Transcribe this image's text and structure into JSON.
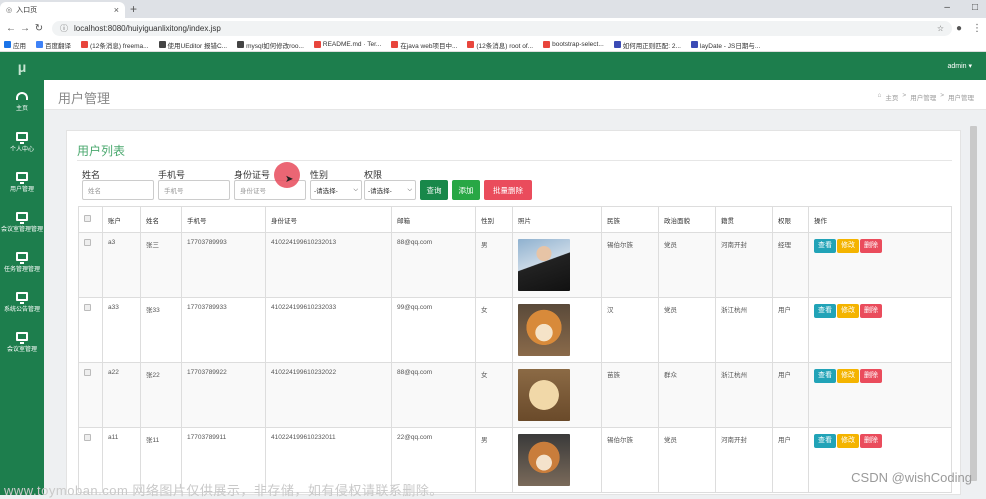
{
  "browser": {
    "tab_title": "入口页",
    "url": "localhost:8080/huiyiguanlixitong/index.jsp",
    "bookmarks": [
      "应用",
      "百度翻译",
      "(12条消息) freema...",
      "使用UEditor 报错C...",
      "mysql如何修改roo...",
      "README.md · Ter...",
      "在java web项目中...",
      "(12条消息) root of...",
      "bootstrap-select...",
      "如何用正则匹配: 2...",
      "layDate - JS日期与..."
    ]
  },
  "app": {
    "logo": "μ",
    "admin": "admin ▾",
    "page_title": "用户管理",
    "breadcrumb": [
      "主页",
      ">",
      "用户管理",
      ">",
      "用户管理"
    ]
  },
  "sidebar": {
    "items": [
      {
        "label": "主页",
        "icon": "dashboard-icon"
      },
      {
        "label": "个人中心",
        "icon": "monitor-icon"
      },
      {
        "label": "用户管理",
        "icon": "monitor-icon"
      },
      {
        "label": "会议室管理管理",
        "icon": "monitor-icon"
      },
      {
        "label": "任务管理管理",
        "icon": "monitor-icon"
      },
      {
        "label": "系统公告管理",
        "icon": "monitor-icon"
      },
      {
        "label": "会议室管理",
        "icon": "monitor-icon"
      }
    ]
  },
  "panel": {
    "title": "用户列表",
    "filters": {
      "name_label": "姓名",
      "name_placeholder": "姓名",
      "phone_label": "手机号",
      "phone_placeholder": "手机号",
      "id_label": "身份证号",
      "id_placeholder": "身份证号",
      "gender_label": "性别",
      "gender_value": "-请选择-",
      "perm_label": "权限",
      "perm_value": "-请选择-"
    },
    "buttons": {
      "search": "查询",
      "add": "添加",
      "batch_delete": "批量删除"
    }
  },
  "table": {
    "headers": [
      "账户",
      "姓名",
      "手机号",
      "身份证号",
      "邮箱",
      "性别",
      "照片",
      "民族",
      "政治面貌",
      "籍贯",
      "权限",
      "操作"
    ],
    "rows": [
      {
        "account": "a3",
        "name": "张三",
        "phone": "17703789993",
        "idcard": "410224199610232013",
        "email": "88@qq.com",
        "gender": "男",
        "ethnic": "锡伯尔族",
        "political": "党员",
        "origin": "河南开封",
        "perm": "经理"
      },
      {
        "account": "a33",
        "name": "张33",
        "phone": "17703789933",
        "idcard": "410224199610232033",
        "email": "99@qq.com",
        "gender": "女",
        "ethnic": "汉",
        "political": "党员",
        "origin": "浙江杭州",
        "perm": "用户"
      },
      {
        "account": "a22",
        "name": "张22",
        "phone": "17703789922",
        "idcard": "410224199610232022",
        "email": "88@qq.com",
        "gender": "女",
        "ethnic": "苗族",
        "political": "群众",
        "origin": "浙江杭州",
        "perm": "用户"
      },
      {
        "account": "a11",
        "name": "张11",
        "phone": "17703789911",
        "idcard": "410224199610232011",
        "email": "22@qq.com",
        "gender": "男",
        "ethnic": "锡伯尔族",
        "political": "党员",
        "origin": "河南开封",
        "perm": "用户"
      }
    ],
    "actions": {
      "view": "查看",
      "edit": "修改",
      "delete": "删除"
    }
  },
  "watermarks": {
    "left": "www.toymoban.com 网络图片仅供展示，非存储，如有侵权请联系删除。",
    "right": "CSDN @wishCoding"
  },
  "colors": {
    "sidebar": "#1d7e4d",
    "title_green": "#4aa86e",
    "view_btn": "#21a3b7",
    "edit_btn": "#f4b400",
    "delete_btn": "#ea4c5c",
    "search_btn": "#18884a",
    "add_btn": "#28a745"
  }
}
